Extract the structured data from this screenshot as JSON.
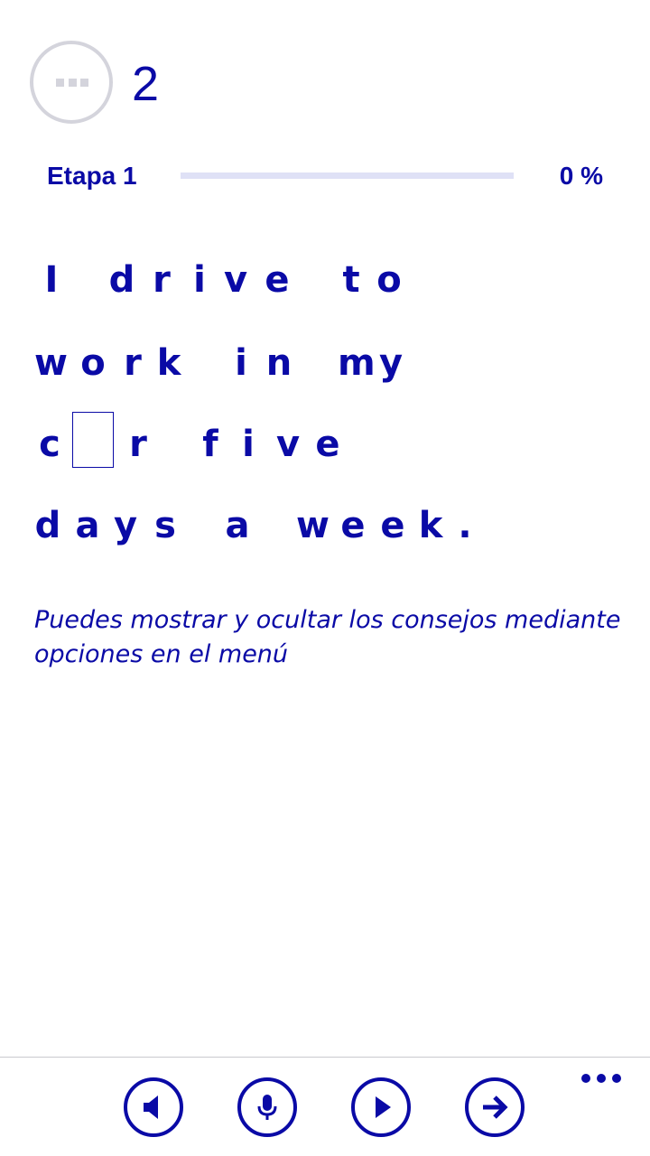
{
  "header": {
    "counter": "2",
    "status_icon": "dots-circle-icon"
  },
  "stage": {
    "label": "Etapa 1",
    "progress_text": "0 %",
    "progress_fraction": 0
  },
  "sentence": {
    "lines": [
      "I drive to",
      "work in my",
      "c_r five",
      "days a week."
    ],
    "line1": [
      {
        "ch": "I"
      },
      {
        "ch": "d"
      },
      {
        "ch": "r"
      },
      {
        "ch": "i"
      },
      {
        "ch": "v"
      },
      {
        "ch": "e"
      },
      {
        "ch": "t"
      },
      {
        "ch": "o"
      }
    ],
    "line2": [
      {
        "ch": "w"
      },
      {
        "ch": "o"
      },
      {
        "ch": "r"
      },
      {
        "ch": "k"
      },
      {
        "ch": "i"
      },
      {
        "ch": "n"
      },
      {
        "ch": "m"
      },
      {
        "ch": "y"
      }
    ],
    "line3": [
      {
        "ch": "c"
      },
      {
        "ch": "r"
      },
      {
        "ch": "f"
      },
      {
        "ch": "i"
      },
      {
        "ch": "v"
      },
      {
        "ch": "e"
      }
    ],
    "line4": [
      {
        "ch": "d"
      },
      {
        "ch": "a"
      },
      {
        "ch": "y"
      },
      {
        "ch": "s"
      },
      {
        "ch": "a"
      },
      {
        "ch": "w"
      },
      {
        "ch": "e"
      },
      {
        "ch": "e"
      },
      {
        "ch": "k"
      },
      {
        "ch": "."
      }
    ]
  },
  "tip": "Puedes mostrar y ocultar los consejos mediante opciones en el menú",
  "appbar": {
    "buttons": [
      {
        "icon": "speaker-icon"
      },
      {
        "icon": "microphone-icon"
      },
      {
        "icon": "play-icon"
      },
      {
        "icon": "arrow-right-icon"
      }
    ],
    "more_icon": "ellipsis-icon"
  },
  "colors": {
    "accent": "#0a0aa6",
    "track": "#dfe1f6",
    "status_gray": "#d4d4dc",
    "divider": "#c9c9cf"
  }
}
